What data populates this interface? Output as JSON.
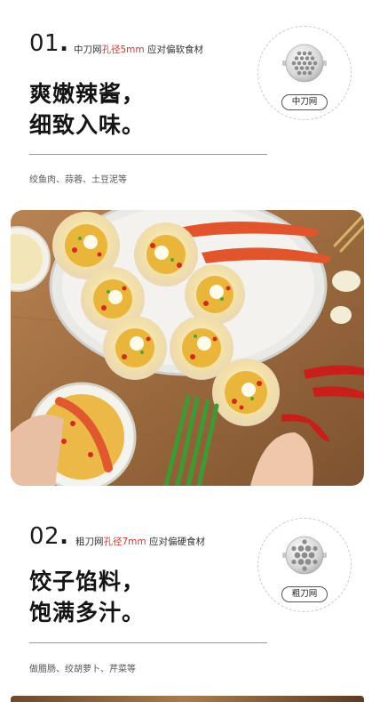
{
  "section1": {
    "number": "01",
    "subtitle_prefix": "中刀网",
    "subtitle_highlight": "孔径5mm",
    "subtitle_suffix": " 应对偏软食材",
    "headline_line1": "爽嫩辣酱，",
    "headline_line2": "细致入味。",
    "foods": "绞鱼肉、蒜蓉、土豆泥等",
    "badge_label": "中刀网",
    "plate_icon": "medium-grinder-plate-icon"
  },
  "section2": {
    "number": "02",
    "subtitle_prefix": "粗刀网",
    "subtitle_highlight": "孔径7mm",
    "subtitle_suffix": " 应对偏硬食材",
    "headline_line1": "饺子馅料，",
    "headline_line2": "饱满多汁。",
    "foods": "做腊肠、绞胡萝卜、芹菜等",
    "badge_label": "粗刀网",
    "plate_icon": "coarse-grinder-plate-icon"
  },
  "colors": {
    "accent_red": "#e0322b",
    "text_dark": "#141414",
    "wood": "#9b6a3e"
  }
}
